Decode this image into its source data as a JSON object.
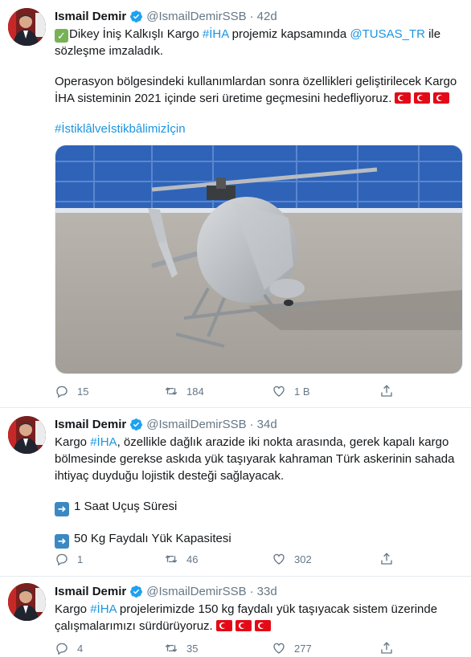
{
  "tweets": [
    {
      "name": "Ismail Demir",
      "handle": "@IsmailDemirSSB",
      "time": "42d",
      "text": {
        "l1_a": "Dikey İniş Kalkışlı Kargo ",
        "l1_tag": "#İHA",
        "l1_b": " projemiz kapsamında ",
        "l1_mention": "@TUSAS_TR",
        "l1_c": " ile",
        "l2": "sözleşme imzaladık.",
        "l3": "Operasyon bölgesindeki kullanımlardan sonra özellikleri geliştirilecek Kargo",
        "l4": "İHA sisteminin 2021 içinde seri üretime geçmesini hedefliyoruz.",
        "l5_tag": "#İstiklâlveİstikbâlimizİçin"
      },
      "replies": "15",
      "retweets": "184",
      "likes": "1 B"
    },
    {
      "name": "Ismail Demir",
      "handle": "@IsmailDemirSSB",
      "time": "34d",
      "text": {
        "l1_a": "Kargo ",
        "l1_tag": "#İHA",
        "l1_b": ", özellikle dağlık arazide iki nokta arasında, gerek kapalı kargo",
        "l2": "bölmesinde gerekse askıda yük taşıyarak kahraman Türk askerinin sahada",
        "l3": "ihtiyaç duyduğu lojistik desteği sağlayacak.",
        "l4": "1 Saat Uçuş Süresi",
        "l5": "50 Kg Faydalı Yük Kapasitesi"
      },
      "replies": "1",
      "retweets": "46",
      "likes": "302"
    },
    {
      "name": "Ismail Demir",
      "handle": "@IsmailDemirSSB",
      "time": "33d",
      "text": {
        "l1_a": "Kargo ",
        "l1_tag": "#İHA",
        "l1_b": " projelerimizde 150 kg faydalı yük taşıyacak sistem üzerinde",
        "l2": "çalışmalarımızı sürdürüyoruz."
      },
      "replies": "4",
      "retweets": "35",
      "likes": "277"
    }
  ],
  "colors": {
    "link": "#1b95e0",
    "secondary": "#657786",
    "verified": "#1da1f2"
  },
  "icons": [
    "verified-badge-icon",
    "reply-icon",
    "retweet-icon",
    "like-icon",
    "share-icon",
    "check-mark-icon",
    "right-arrow-icon",
    "turkish-flag-icon"
  ]
}
